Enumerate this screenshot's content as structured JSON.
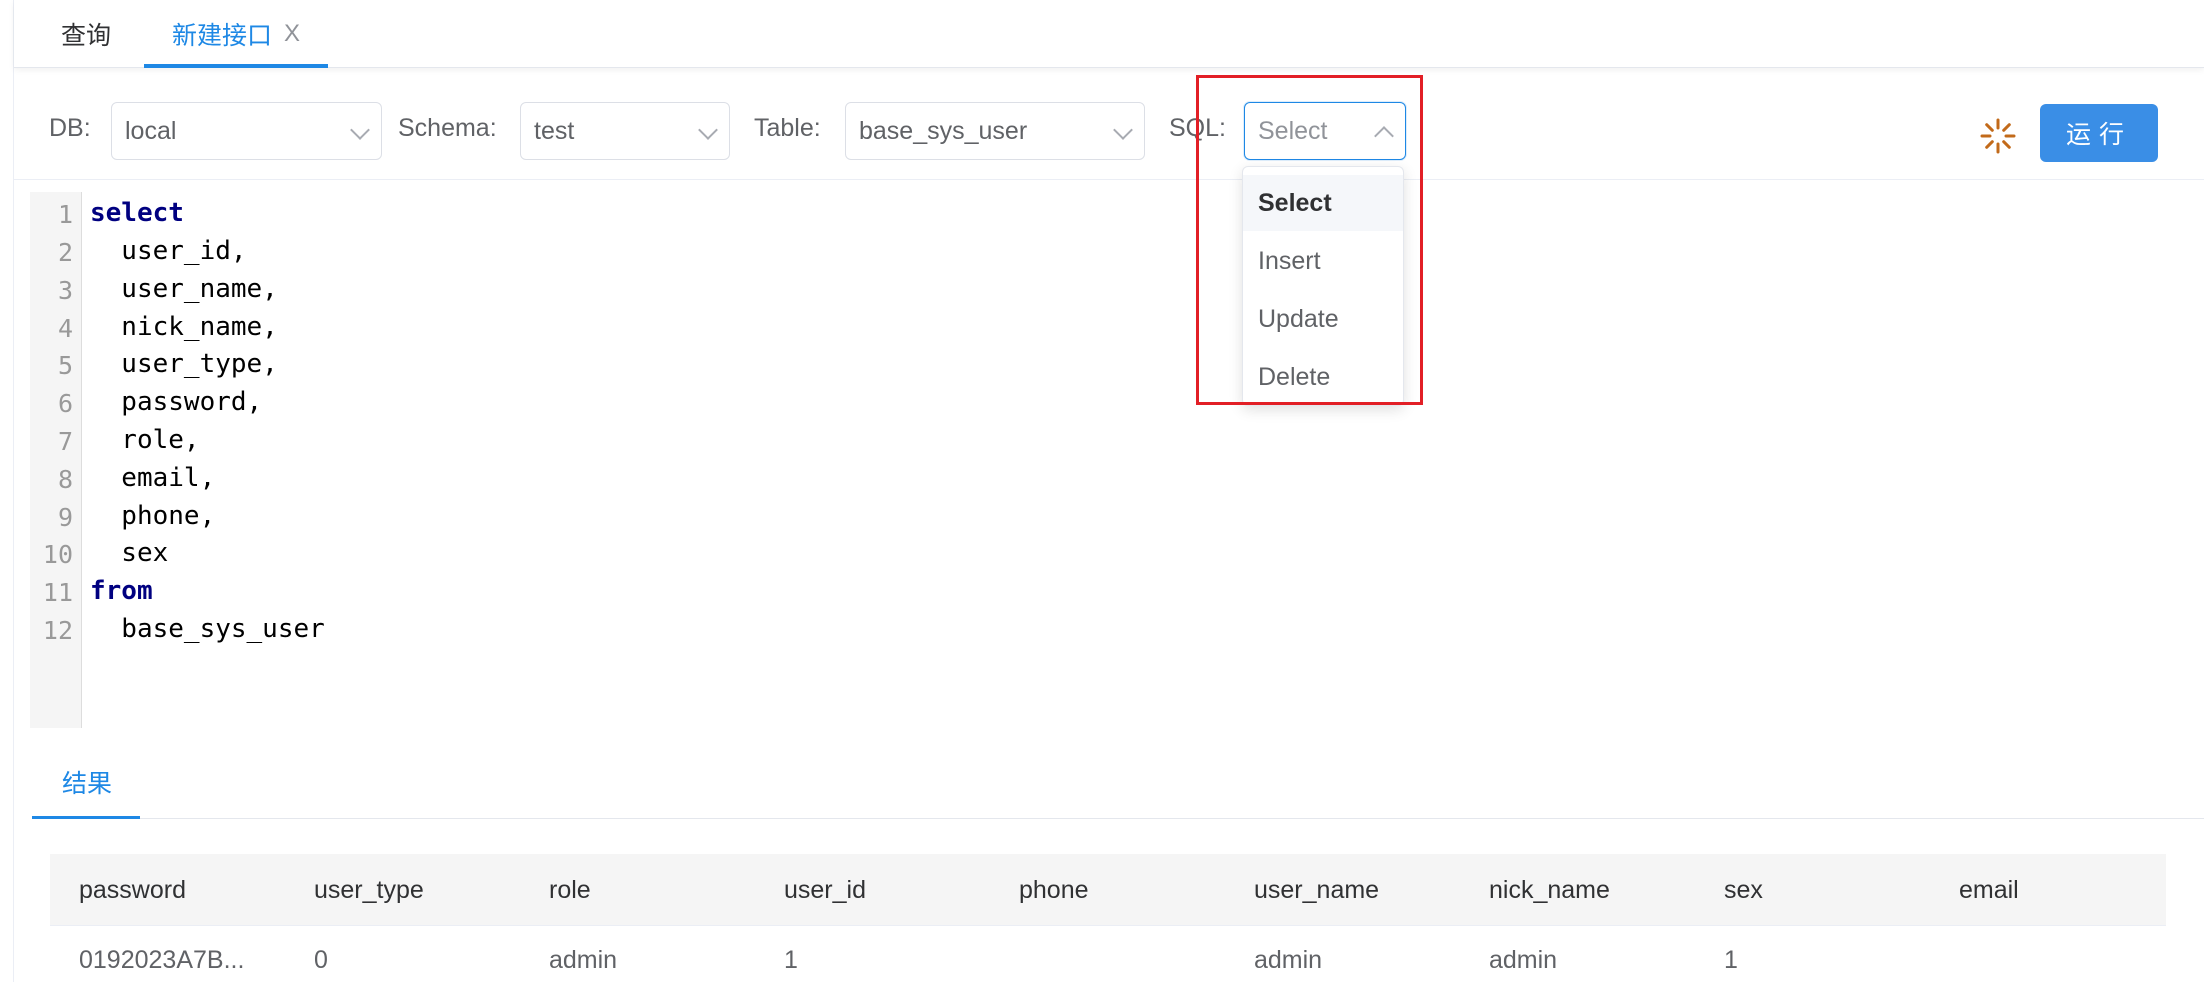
{
  "tabs": {
    "query": "查询",
    "new_api": "新建接口",
    "close": "X"
  },
  "toolbar": {
    "db_label": "DB:",
    "db_value": "local",
    "schema_label": "Schema:",
    "schema_value": "test",
    "table_label": "Table:",
    "table_value": "base_sys_user",
    "sql_label": "SQL:",
    "sql_value": "Select",
    "run_label": "运行"
  },
  "sql_options": [
    "Select",
    "Insert",
    "Update",
    "Delete"
  ],
  "editor": {
    "line_numbers": [
      "1",
      "2",
      "3",
      "4",
      "5",
      "6",
      "7",
      "8",
      "9",
      "10",
      "11",
      "12"
    ],
    "lines": [
      "select",
      "  user_id,",
      "  user_name,",
      "  nick_name,",
      "  user_type,",
      "  password,",
      "  role,",
      "  email,",
      "  phone,",
      "  sex",
      "from",
      "  base_sys_user"
    ]
  },
  "results": {
    "tab_label": "结果",
    "columns": [
      "password",
      "user_type",
      "role",
      "user_id",
      "phone",
      "user_name",
      "nick_name",
      "sex",
      "email"
    ],
    "rows": [
      [
        "0192023A7B...",
        "0",
        "admin",
        "1",
        "",
        "admin",
        "admin",
        "1",
        ""
      ]
    ]
  },
  "colors": {
    "accent": "#1e88e5",
    "run_button": "#3a8ee6",
    "highlight": "#e21f26",
    "spinner": "#c26a1a"
  }
}
